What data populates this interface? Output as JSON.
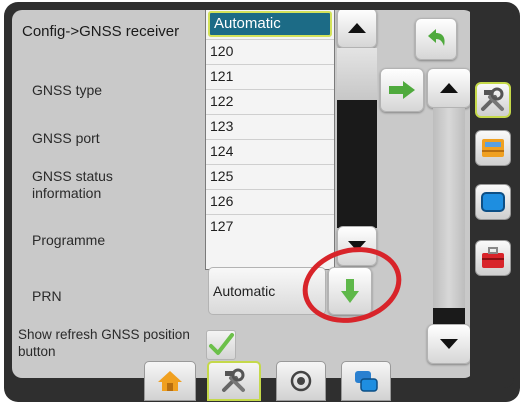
{
  "header": {
    "title": "Config->GNSS receiver"
  },
  "settings": {
    "labels": [
      "GNSS type",
      "GNSS port",
      "GNSS status information",
      "Programme",
      "PRN",
      "Show refresh GNSS position button"
    ]
  },
  "dropdown": {
    "selected": "Automatic",
    "options": [
      "120",
      "121",
      "122",
      "123",
      "124",
      "125",
      "126",
      "127"
    ]
  },
  "prn": {
    "value": "Automatic"
  },
  "refresh_button": {
    "checked": true
  },
  "colors": {
    "accent_green": "#6cc04a",
    "selection_blue": "#1c6b86",
    "highlight_yellow": "#d3e25a",
    "annotation_red": "#d8242a"
  },
  "icons": {
    "side": [
      "tools-icon",
      "console-icon",
      "display-icon",
      "toolbox-icon"
    ],
    "bottom": [
      "home-icon",
      "tools-icon",
      "target-icon",
      "pages-icon"
    ]
  }
}
